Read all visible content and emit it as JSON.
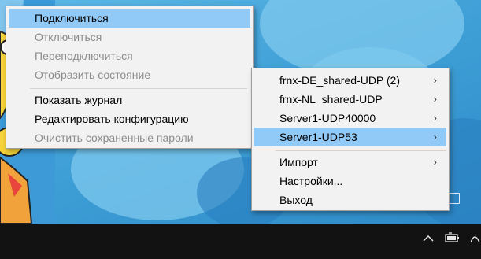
{
  "main_menu": {
    "items": [
      {
        "label": "Подключиться",
        "enabled": true,
        "highlighted": true
      },
      {
        "label": "Отключиться",
        "enabled": false
      },
      {
        "label": "Переподключиться",
        "enabled": false
      },
      {
        "label": "Отобразить состояние",
        "enabled": false
      },
      {
        "label": "Показать журнал",
        "enabled": true
      },
      {
        "label": "Редактировать конфигурацию",
        "enabled": true
      },
      {
        "label": "Очистить сохраненные пароли",
        "enabled": false
      }
    ]
  },
  "sub_menu": {
    "items": [
      {
        "label": "frnx-DE_shared-UDP (2)",
        "submenu": true
      },
      {
        "label": "frnx-NL_shared-UDP",
        "submenu": true
      },
      {
        "label": "Server1-UDP40000",
        "submenu": true
      },
      {
        "label": "Server1-UDP53",
        "submenu": true,
        "highlighted": true
      },
      {
        "label": "Импорт",
        "submenu": true
      },
      {
        "label": "Настройки...",
        "submenu": false
      },
      {
        "label": "Выход",
        "submenu": false
      }
    ],
    "arrow_glyph": "›"
  },
  "colors": {
    "menu_bg": "#f2f2f2",
    "highlight": "#91c9f7",
    "disabled_text": "#8c8c8c",
    "taskbar": "#121212"
  },
  "tray": {
    "icons": [
      "chevron-up-icon",
      "battery-icon",
      "network-icon"
    ]
  }
}
